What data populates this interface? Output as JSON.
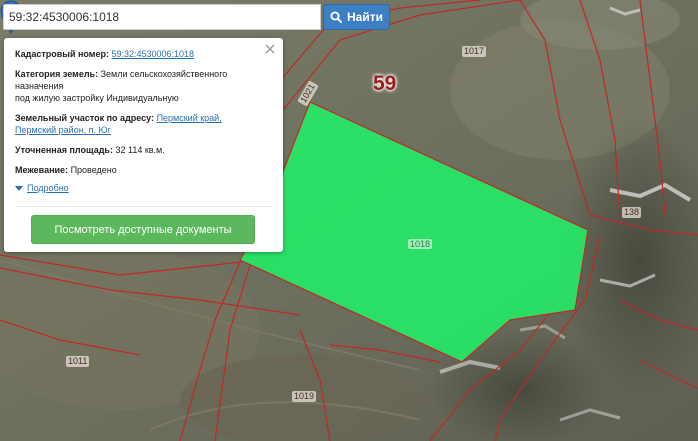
{
  "search": {
    "value": "59:32:4530006:1018",
    "button_label": "Найти"
  },
  "popup": {
    "cadastral_label": "Кадастровый номер:",
    "cadastral_value": "59:32:4530006:1018",
    "category_label": "Категория земель:",
    "category_value": "Земли сельскохозяйственного назначения",
    "use_value": "под жилую застройку Индивидуальную",
    "address_label": "Земельный участок по адресу:",
    "address_value_line1": "Пермский край,",
    "address_value_line2": "Пермский район, п. Юг",
    "area_label": "Уточненная площадь:",
    "area_value": "32 114 кв.м.",
    "survey_label": "Межевание:",
    "survey_value": "Проведено",
    "more_label": "Подробно",
    "docs_button_label": "Посмотреть доступные документы"
  },
  "map": {
    "region_label": "59",
    "selected_parcel_label": "1018",
    "parcel_labels": [
      "1017",
      "1021",
      "138",
      "1011",
      "1019"
    ],
    "colors": {
      "selected_fill": "#22ee66",
      "boundary": "#c02828",
      "marker": "#2f6fbf"
    }
  }
}
